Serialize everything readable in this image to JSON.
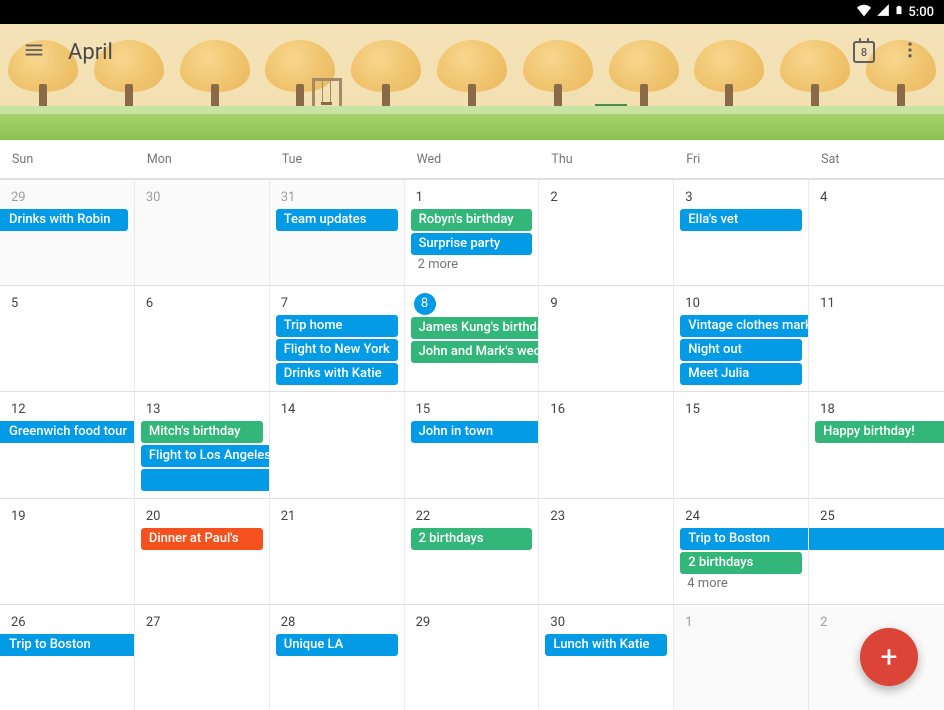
{
  "status": {
    "time": "5:00"
  },
  "header": {
    "title": "April",
    "today_icon_day": "8"
  },
  "weekdays": [
    "Sun",
    "Mon",
    "Tue",
    "Wed",
    "Thu",
    "Fri",
    "Sat"
  ],
  "colors": {
    "blue": "#039be5",
    "green": "#33b679",
    "orange": "#f4511e",
    "fab": "#db4437"
  },
  "cells": [
    {
      "day": "29",
      "outside": true,
      "events": [
        {
          "label": "Drinks with Robin",
          "color": "blue",
          "spanLeft": true
        }
      ]
    },
    {
      "day": "30",
      "outside": true,
      "events": []
    },
    {
      "day": "31",
      "outside": true,
      "events": [
        {
          "label": "Team updates",
          "color": "blue"
        }
      ]
    },
    {
      "day": "1",
      "events": [
        {
          "label": "Robyn's birthday",
          "color": "green"
        },
        {
          "label": "Surprise party",
          "color": "blue"
        }
      ],
      "more": "2 more"
    },
    {
      "day": "2",
      "events": []
    },
    {
      "day": "3",
      "events": [
        {
          "label": "Ella's vet",
          "color": "blue"
        }
      ]
    },
    {
      "day": "4",
      "events": []
    },
    {
      "day": "5",
      "events": []
    },
    {
      "day": "6",
      "events": []
    },
    {
      "day": "7",
      "events": [
        {
          "label": "Trip home",
          "color": "blue"
        },
        {
          "label": "Flight to New York",
          "color": "blue"
        },
        {
          "label": "Drinks with Katie",
          "color": "blue"
        }
      ]
    },
    {
      "day": "8",
      "today": true,
      "events": [
        {
          "label": "James Kung's birthday",
          "color": "green",
          "spanRight": true
        },
        {
          "label": "John and Mark's wedding",
          "color": "green",
          "spanRight": true
        }
      ]
    },
    {
      "day": "9",
      "events": []
    },
    {
      "day": "10",
      "events": [
        {
          "label": "Vintage clothes market",
          "color": "blue",
          "spanRight": true
        },
        {
          "label": "Night out",
          "color": "blue"
        },
        {
          "label": "Meet Julia",
          "color": "blue"
        }
      ]
    },
    {
      "day": "11",
      "events": []
    },
    {
      "day": "12",
      "events": [
        {
          "label": "Greenwich food tour",
          "color": "blue",
          "spanLeft": true,
          "spanRight": true
        }
      ]
    },
    {
      "day": "13",
      "events": [
        {
          "label": "Mitch's birthday",
          "color": "green"
        },
        {
          "label": "Flight to Los Angeles",
          "color": "blue",
          "spanRight": true
        },
        {
          "label": "",
          "color": "blue",
          "spanRight": true
        }
      ]
    },
    {
      "day": "14",
      "events": []
    },
    {
      "day": "15",
      "events": [
        {
          "label": "John in town",
          "color": "blue",
          "spanRight": true
        }
      ]
    },
    {
      "day": "16",
      "events": []
    },
    {
      "day": "15",
      "events": []
    },
    {
      "day": "18",
      "events": [
        {
          "label": "Happy birthday!",
          "color": "green",
          "spanRight": true
        }
      ]
    },
    {
      "day": "19",
      "events": []
    },
    {
      "day": "20",
      "events": [
        {
          "label": "Dinner at Paul's",
          "color": "orange"
        }
      ]
    },
    {
      "day": "21",
      "events": []
    },
    {
      "day": "22",
      "events": [
        {
          "label": "2 birthdays",
          "color": "green"
        }
      ]
    },
    {
      "day": "23",
      "events": []
    },
    {
      "day": "24",
      "events": [
        {
          "label": "Trip to Boston",
          "color": "blue",
          "spanRight": true
        },
        {
          "label": "2 birthdays",
          "color": "green"
        }
      ],
      "more": "4 more"
    },
    {
      "day": "25",
      "events": [
        {
          "label": "",
          "color": "blue",
          "spanLeft": true,
          "spanRight": true
        }
      ]
    },
    {
      "day": "26",
      "events": [
        {
          "label": "Trip to Boston",
          "color": "blue",
          "spanLeft": true,
          "spanRight": true
        }
      ]
    },
    {
      "day": "27",
      "events": []
    },
    {
      "day": "28",
      "events": [
        {
          "label": "Unique LA",
          "color": "blue"
        }
      ]
    },
    {
      "day": "29",
      "events": []
    },
    {
      "day": "30",
      "events": [
        {
          "label": "Lunch with Katie",
          "color": "blue"
        }
      ]
    },
    {
      "day": "1",
      "outside": true,
      "events": []
    },
    {
      "day": "2",
      "outside": true,
      "events": []
    }
  ]
}
